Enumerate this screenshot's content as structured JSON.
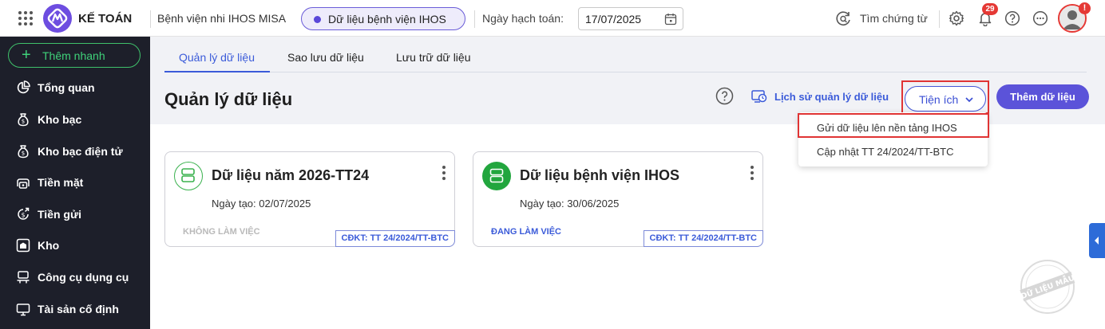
{
  "header": {
    "app_name": "KẾ TOÁN",
    "unit_name": "Bệnh viện nhi IHOS MISA",
    "database_name": "Dữ liệu bệnh viện IHOS",
    "posting_date_label": "Ngày hạch toán:",
    "posting_date_value": "17/07/2025",
    "search_document": "Tìm chứng từ",
    "notification_count": "29",
    "avatar_alert": "!"
  },
  "sidebar": {
    "quick_add": "Thêm nhanh",
    "items": [
      {
        "label": "Tổng quan",
        "icon": "pie-chart-icon"
      },
      {
        "label": "Kho bạc",
        "icon": "treasury-icon"
      },
      {
        "label": "Kho bạc điện tử",
        "icon": "e-treasury-icon"
      },
      {
        "label": "Tiền mặt",
        "icon": "cash-icon"
      },
      {
        "label": "Tiền gửi",
        "icon": "deposit-icon"
      },
      {
        "label": "Kho",
        "icon": "warehouse-icon"
      },
      {
        "label": "Công cụ dụng cụ",
        "icon": "tools-icon"
      },
      {
        "label": "Tài sản cố định",
        "icon": "fixed-asset-icon"
      }
    ]
  },
  "tabs": [
    {
      "label": "Quản lý dữ liệu",
      "active": true
    },
    {
      "label": "Sao lưu dữ liệu",
      "active": false
    },
    {
      "label": "Lưu trữ dữ liệu",
      "active": false
    }
  ],
  "page": {
    "title": "Quản lý dữ liệu",
    "history_link": "Lịch sử quản lý dữ liệu",
    "utilities_button": "Tiện ích",
    "add_data_button": "Thêm dữ liệu"
  },
  "dropdown": {
    "items": [
      {
        "label": "Gửi dữ liệu lên nền tảng IHOS"
      },
      {
        "label": "Cập nhật TT 24/2024/TT-BTC"
      }
    ]
  },
  "cards": [
    {
      "title": "Dữ liệu năm 2026-TT24",
      "created": "Ngày tạo: 02/07/2025",
      "status": "KHÔNG LÀM VIỆC",
      "regime": "CĐKT: TT 24/2024/TT-BTC",
      "active": false
    },
    {
      "title": "Dữ liệu bệnh viện IHOS",
      "created": "Ngày tạo: 30/06/2025",
      "status": "ĐANG LÀM VIỆC",
      "regime": "CĐKT: TT 24/2024/TT-BTC",
      "active": true
    }
  ],
  "watermark": "DỮ LIỆU MẪU",
  "colors": {
    "accent": "#5b53d9",
    "link": "#3b5bd9",
    "sidebar_bg": "#1d1f2a",
    "quick_add": "#3fd27a",
    "highlight": "#e03434",
    "active_db": "#22a63e",
    "inactive_db": "#3bb24f"
  }
}
